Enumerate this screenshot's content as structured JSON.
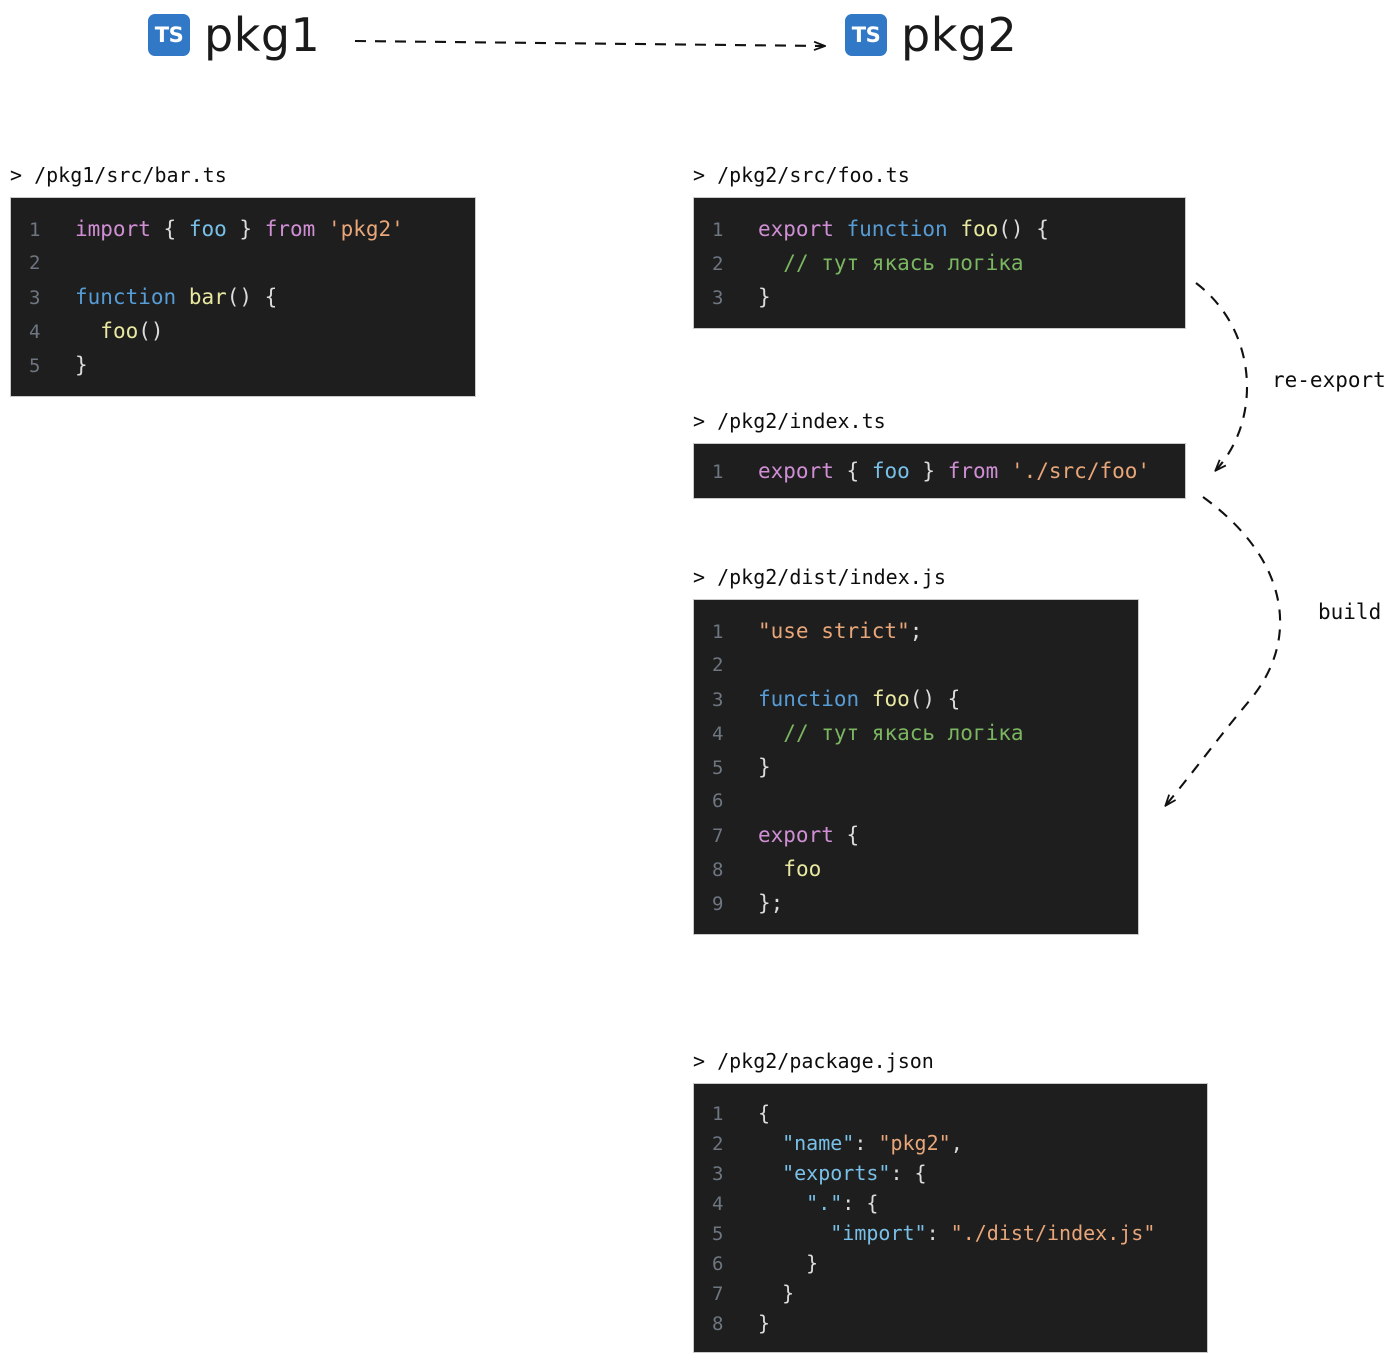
{
  "packages": [
    {
      "id": "pkg1",
      "name": "pkg1",
      "logo": "typescript-logo",
      "logo_text": "TS"
    },
    {
      "id": "pkg2",
      "name": "pkg2",
      "logo": "typescript-logo",
      "logo_text": "TS"
    }
  ],
  "edges": [
    {
      "id": "pkg1-to-pkg2",
      "label": "",
      "style": "dashed-arrow"
    },
    {
      "id": "foo-to-index",
      "label": "re-export",
      "style": "dashed-curved-arrow"
    },
    {
      "id": "index-to-dist",
      "label": "build",
      "style": "dashed-curved-arrow"
    }
  ],
  "labels": {
    "re_export": "re-export",
    "build": "build"
  },
  "files": {
    "bar_ts": {
      "path": "> /pkg1/src/bar.ts",
      "lines": [
        {
          "n": "1",
          "tokens": [
            {
              "t": "import",
              "c": "t-kw"
            },
            {
              "t": " ",
              "c": "t-pun"
            },
            {
              "t": "{",
              "c": "t-pun"
            },
            {
              "t": " ",
              "c": "t-pun"
            },
            {
              "t": "foo",
              "c": "t-id"
            },
            {
              "t": " ",
              "c": "t-pun"
            },
            {
              "t": "}",
              "c": "t-pun"
            },
            {
              "t": " ",
              "c": "t-pun"
            },
            {
              "t": "from",
              "c": "t-kw"
            },
            {
              "t": " ",
              "c": "t-pun"
            },
            {
              "t": "'pkg2'",
              "c": "t-str"
            }
          ]
        },
        {
          "n": "2",
          "tokens": []
        },
        {
          "n": "3",
          "tokens": [
            {
              "t": "function",
              "c": "t-fn"
            },
            {
              "t": " ",
              "c": "t-pun"
            },
            {
              "t": "bar",
              "c": "t-name"
            },
            {
              "t": "() {",
              "c": "t-pun"
            }
          ]
        },
        {
          "n": "4",
          "tokens": [
            {
              "t": "  ",
              "c": "t-pun"
            },
            {
              "t": "foo",
              "c": "t-name"
            },
            {
              "t": "()",
              "c": "t-pun"
            }
          ]
        },
        {
          "n": "5",
          "tokens": [
            {
              "t": "}",
              "c": "t-pun"
            }
          ]
        }
      ]
    },
    "foo_ts": {
      "path": "> /pkg2/src/foo.ts",
      "lines": [
        {
          "n": "1",
          "tokens": [
            {
              "t": "export",
              "c": "t-kw"
            },
            {
              "t": " ",
              "c": "t-pun"
            },
            {
              "t": "function",
              "c": "t-fn"
            },
            {
              "t": " ",
              "c": "t-pun"
            },
            {
              "t": "foo",
              "c": "t-name"
            },
            {
              "t": "() {",
              "c": "t-pun"
            }
          ]
        },
        {
          "n": "2",
          "tokens": [
            {
              "t": "  ",
              "c": "t-pun"
            },
            {
              "t": "// тут якась логіка",
              "c": "t-cmt"
            }
          ]
        },
        {
          "n": "3",
          "tokens": [
            {
              "t": "}",
              "c": "t-pun"
            }
          ]
        }
      ]
    },
    "index_ts": {
      "path": "> /pkg2/index.ts",
      "lines": [
        {
          "n": "1",
          "tokens": [
            {
              "t": "export",
              "c": "t-kw"
            },
            {
              "t": " ",
              "c": "t-pun"
            },
            {
              "t": "{",
              "c": "t-pun"
            },
            {
              "t": " ",
              "c": "t-pun"
            },
            {
              "t": "foo",
              "c": "t-id"
            },
            {
              "t": " ",
              "c": "t-pun"
            },
            {
              "t": "}",
              "c": "t-pun"
            },
            {
              "t": " ",
              "c": "t-pun"
            },
            {
              "t": "from",
              "c": "t-kw"
            },
            {
              "t": " ",
              "c": "t-pun"
            },
            {
              "t": "'./src/foo'",
              "c": "t-str"
            }
          ]
        }
      ]
    },
    "dist_index_js": {
      "path": "> /pkg2/dist/index.js",
      "lines": [
        {
          "n": "1",
          "tokens": [
            {
              "t": "\"use strict\"",
              "c": "t-str"
            },
            {
              "t": ";",
              "c": "t-pun"
            }
          ]
        },
        {
          "n": "2",
          "tokens": []
        },
        {
          "n": "3",
          "tokens": [
            {
              "t": "function",
              "c": "t-fn"
            },
            {
              "t": " ",
              "c": "t-pun"
            },
            {
              "t": "foo",
              "c": "t-name"
            },
            {
              "t": "() {",
              "c": "t-pun"
            }
          ]
        },
        {
          "n": "4",
          "tokens": [
            {
              "t": "  ",
              "c": "t-pun"
            },
            {
              "t": "// тут якась логіка",
              "c": "t-cmt"
            }
          ]
        },
        {
          "n": "5",
          "tokens": [
            {
              "t": "}",
              "c": "t-pun"
            }
          ]
        },
        {
          "n": "6",
          "tokens": []
        },
        {
          "n": "7",
          "tokens": [
            {
              "t": "export",
              "c": "t-kw"
            },
            {
              "t": " ",
              "c": "t-pun"
            },
            {
              "t": "{",
              "c": "t-pun"
            }
          ]
        },
        {
          "n": "8",
          "tokens": [
            {
              "t": "  ",
              "c": "t-pun"
            },
            {
              "t": "foo",
              "c": "t-name"
            }
          ]
        },
        {
          "n": "9",
          "tokens": [
            {
              "t": "};",
              "c": "t-pun"
            }
          ]
        }
      ]
    },
    "package_json": {
      "path": "> /pkg2/package.json",
      "lines": [
        {
          "n": "1",
          "tokens": [
            {
              "t": "{",
              "c": "t-pun"
            }
          ]
        },
        {
          "n": "2",
          "tokens": [
            {
              "t": "  ",
              "c": "t-pun"
            },
            {
              "t": "\"name\"",
              "c": "t-key"
            },
            {
              "t": ": ",
              "c": "t-pun"
            },
            {
              "t": "\"pkg2\"",
              "c": "t-str"
            },
            {
              "t": ",",
              "c": "t-pun"
            }
          ]
        },
        {
          "n": "3",
          "tokens": [
            {
              "t": "  ",
              "c": "t-pun"
            },
            {
              "t": "\"exports\"",
              "c": "t-key"
            },
            {
              "t": ": {",
              "c": "t-pun"
            }
          ]
        },
        {
          "n": "4",
          "tokens": [
            {
              "t": "    ",
              "c": "t-pun"
            },
            {
              "t": "\".\"",
              "c": "t-key"
            },
            {
              "t": ": {",
              "c": "t-pun"
            }
          ]
        },
        {
          "n": "5",
          "tokens": [
            {
              "t": "      ",
              "c": "t-pun"
            },
            {
              "t": "\"import\"",
              "c": "t-key"
            },
            {
              "t": ": ",
              "c": "t-pun"
            },
            {
              "t": "\"./dist/index.js\"",
              "c": "t-str"
            }
          ]
        },
        {
          "n": "6",
          "tokens": [
            {
              "t": "    }",
              "c": "t-pun"
            }
          ]
        },
        {
          "n": "7",
          "tokens": [
            {
              "t": "  }",
              "c": "t-pun"
            }
          ]
        },
        {
          "n": "8",
          "tokens": [
            {
              "t": "}",
              "c": "t-pun"
            }
          ]
        }
      ]
    }
  },
  "colors": {
    "typescript_blue": "#3178c6",
    "code_background": "#1e1e1e",
    "keyword": "#d08fd4",
    "function_keyword": "#569cd6",
    "identifier": "#79c0e8",
    "function_name": "#e8e8a0",
    "string": "#e8a679",
    "comment": "#7bb661"
  }
}
